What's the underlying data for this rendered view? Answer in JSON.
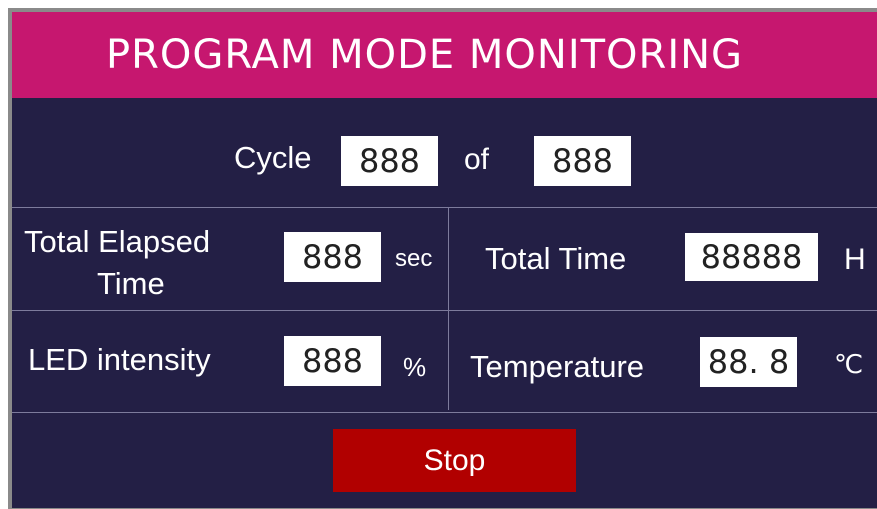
{
  "title": "PROGRAM MODE  MONITORING",
  "cycle": {
    "label": "Cycle",
    "current": "888",
    "of_label": "of",
    "total": "888"
  },
  "elapsed": {
    "label_line1": "Total Elapsed",
    "label_line2": "Time",
    "value": "888",
    "unit": "sec"
  },
  "total_time": {
    "label": "Total Time",
    "value": "88888",
    "unit": "H"
  },
  "led": {
    "label": "LED intensity",
    "value": "888",
    "unit": "%"
  },
  "temperature": {
    "label": "Temperature",
    "value": "88. 8",
    "unit": "℃"
  },
  "stop_label": "Stop",
  "colors": {
    "header": "#c6176f",
    "background": "#231f45",
    "stop_button": "#b10000"
  }
}
